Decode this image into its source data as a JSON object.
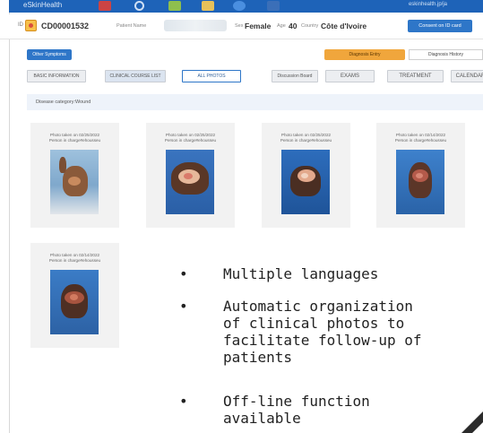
{
  "app": {
    "brand": "eSkinHealth",
    "top_link": "eskinhealth.jp/ja"
  },
  "patient": {
    "id_prefix": "ID",
    "id": "CD00001532",
    "name_label": "Patient Name",
    "sex_label": "Sex",
    "sex": "Female",
    "age_label": "Age",
    "age": "40",
    "country_label": "Country",
    "country": "Côte d'Ivoire",
    "consent_label": "Consent on ID card"
  },
  "actions": {
    "other_symptoms": "Other Symptoms",
    "diagnosis_entry": "Diagnosis Entry",
    "diagnosis_history": "Diagnosis History"
  },
  "tabs": [
    {
      "label": "BASIC INFORMATION"
    },
    {
      "label": "CLINICAL COURSE LIST"
    },
    {
      "label": "ALL PHOTOS"
    },
    {
      "label": "Discussion Board"
    },
    {
      "label": "EXAMS"
    },
    {
      "label": "TREATMENT"
    },
    {
      "label": "CALENDAR"
    }
  ],
  "category": "Disease category:Wound",
  "photos": [
    {
      "date_line": "Photo taken on 02/25/2022",
      "person_line": "Person in charge#ehousseu"
    },
    {
      "date_line": "Photo taken on 02/25/2022",
      "person_line": "Person in charge#ehousseu"
    },
    {
      "date_line": "Photo taken on 02/25/2022",
      "person_line": "Person in charge#ehousseu"
    },
    {
      "date_line": "Photo taken on 02/14/2022",
      "person_line": "Person in charge#ehousseu"
    },
    {
      "date_line": "Photo taken on 02/14/2022",
      "person_line": "Person in charge#ehousseu"
    }
  ],
  "overlay": {
    "bullets": [
      {
        "dot": "•",
        "text": "Multiple languages"
      },
      {
        "dot": "•",
        "text": "Automatic organization\nof clinical photos to\nfacilitate follow-up of\npatients"
      },
      {
        "dot": "•",
        "text": "Off-line function\navailable"
      }
    ]
  }
}
